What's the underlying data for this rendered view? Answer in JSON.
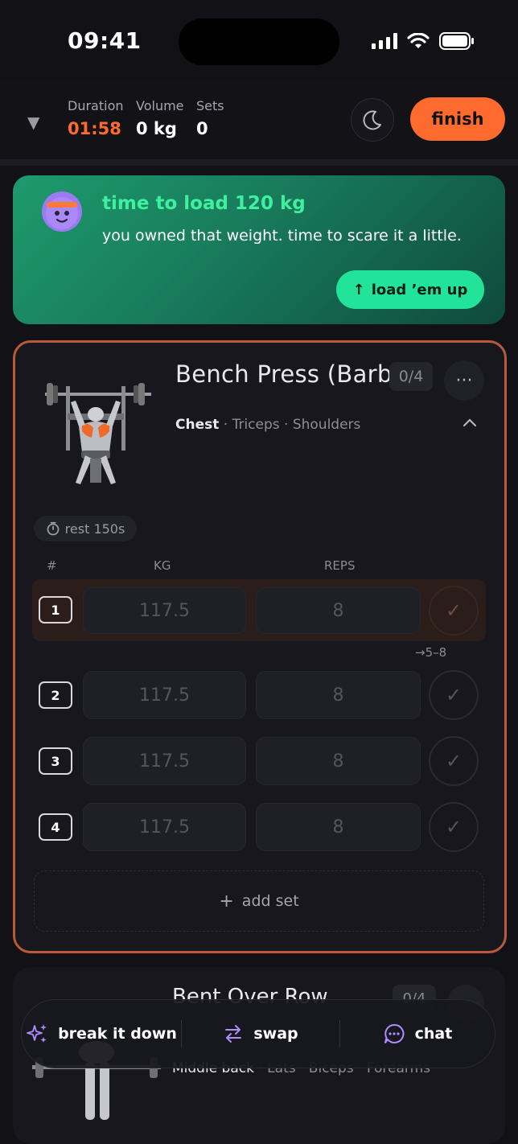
{
  "status": {
    "time": "09:41"
  },
  "header": {
    "duration_label": "Duration",
    "duration_value": "01:58",
    "volume_label": "Volume",
    "volume_value": "0 kg",
    "sets_label": "Sets",
    "sets_value": "0",
    "finish_label": "finish"
  },
  "banner": {
    "title": "time to load 120 kg",
    "message": "you owned that weight. time to scare it a little.",
    "button_label": "load ’em up"
  },
  "exercise": {
    "name": "Bench Press (Barbell)",
    "progress": "0/4",
    "primary_muscle": "Chest",
    "secondary_muscles": " · Triceps · Shoulders",
    "rest": "rest 150s",
    "columns": {
      "number": "#",
      "kg": "KG",
      "reps": "REPS"
    },
    "sets": [
      {
        "number": "1",
        "kg": "117.5",
        "reps": "8"
      },
      {
        "number": "2",
        "kg": "117.5",
        "reps": "8"
      },
      {
        "number": "3",
        "kg": "117.5",
        "reps": "8"
      },
      {
        "number": "4",
        "kg": "117.5",
        "reps": "8"
      }
    ],
    "range_hint": "→5–8",
    "add_set_label": "add set"
  },
  "next_exercise": {
    "name": "Bent Over Row",
    "progress": "0/4",
    "primary_muscle": "Middle back",
    "secondary_muscles": " · Lats · Biceps · Forearms"
  },
  "actions": {
    "break_down_label": "break it down",
    "swap_label": "swap",
    "chat_label": "chat"
  },
  "colors": {
    "accent": "#ff6a2e",
    "banner_green": "#22e39a",
    "card_border": "#b95a3a"
  }
}
